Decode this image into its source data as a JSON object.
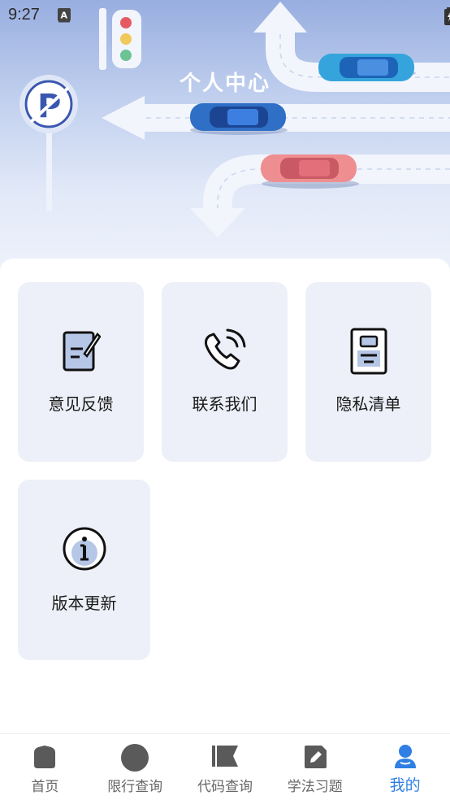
{
  "status_bar": {
    "time": "9:27",
    "left_icons": [
      "download-icon",
      "download-icon",
      "keyboard-a-icon"
    ],
    "right_icons": [
      "wifi-icon",
      "signal-icon",
      "battery-icon"
    ]
  },
  "header": {
    "title": "个人中心"
  },
  "menu": {
    "items": [
      {
        "label": "意见反馈",
        "icon": "feedback-edit-icon"
      },
      {
        "label": "联系我们",
        "icon": "phone-call-icon"
      },
      {
        "label": "隐私清单",
        "icon": "privacy-document-icon"
      },
      {
        "label": "版本更新",
        "icon": "info-icon"
      }
    ]
  },
  "tabbar": {
    "tabs": [
      {
        "label": "首页",
        "icon": "home-icon",
        "active": false
      },
      {
        "label": "限行查询",
        "icon": "restriction-circle-icon",
        "active": false
      },
      {
        "label": "代码查询",
        "icon": "flag-icon",
        "active": false
      },
      {
        "label": "学法习题",
        "icon": "exercise-pen-icon",
        "active": false
      },
      {
        "label": "我的",
        "icon": "user-icon",
        "active": true
      }
    ]
  },
  "colors": {
    "accent": "#2f7fe4",
    "card_bg": "#edf0f8",
    "icon_fill": "#b6c6e6",
    "inactive_icon": "#5a5a5a"
  }
}
